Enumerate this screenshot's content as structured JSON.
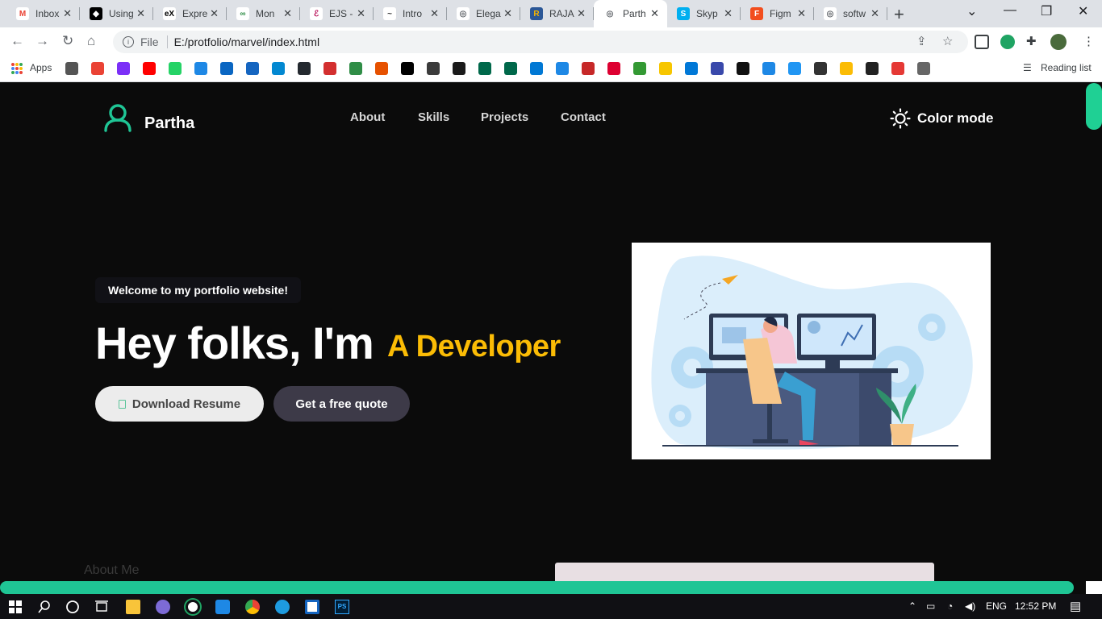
{
  "browser": {
    "tabs": [
      {
        "title": "Inbox",
        "fav": "M",
        "color": "#ffffff",
        "fg": "#ea4335"
      },
      {
        "title": "Using",
        "fav": "◆",
        "color": "#000000",
        "fg": "#ffffff"
      },
      {
        "title": "Expre",
        "fav": "eX",
        "color": "#ffffff",
        "fg": "#000000"
      },
      {
        "title": "Mon",
        "fav": "∞",
        "color": "#ffffff",
        "fg": "#2f8d46"
      },
      {
        "title": "EJS -",
        "fav": "ℰ",
        "color": "#ffffff",
        "fg": "#b4004e"
      },
      {
        "title": "Intro",
        "fav": "~",
        "color": "#ffffff",
        "fg": "#333333"
      },
      {
        "title": "Elega",
        "fav": "◎",
        "color": "#ffffff",
        "fg": "#5f6368"
      },
      {
        "title": "RAJA",
        "fav": "R",
        "color": "#2b5797",
        "fg": "#f4b400"
      },
      {
        "title": "Parth",
        "fav": "◎",
        "color": "#ffffff",
        "fg": "#5f6368",
        "active": true
      },
      {
        "title": "Skyp",
        "fav": "S",
        "color": "#00aff0",
        "fg": "#ffffff"
      },
      {
        "title": "Figm",
        "fav": "F",
        "color": "#f24e1e",
        "fg": "#ffffff"
      },
      {
        "title": "softw",
        "fav": "◎",
        "color": "#ffffff",
        "fg": "#5f6368"
      }
    ],
    "url_scheme": "File",
    "url": "E:/protfolio/marvel/index.html",
    "apps_label": "Apps",
    "reading_list_label": "Reading list",
    "bookmark_colors": [
      "#555555",
      "#ea4335",
      "#7b2ff7",
      "#ff0000",
      "#25d366",
      "#1e88e5",
      "#0a66c2",
      "#1565c0",
      "#0288d1",
      "#24292f",
      "#d32f2f",
      "#2f8d46",
      "#e65100",
      "#000000",
      "#3b3b3b",
      "#1a1a1a",
      "#00684a",
      "#00684a",
      "#0078d4",
      "#1e88e5",
      "#c62828",
      "#dd0031",
      "#339933",
      "#f7c600",
      "#0078d7",
      "#3949ab",
      "#111111",
      "#1e88e5",
      "#2196f3",
      "#333333",
      "#fbbc05",
      "#222222",
      "#e53935",
      "#666666"
    ]
  },
  "site": {
    "brand": "Partha",
    "nav": [
      "About",
      "Skills",
      "Projects",
      "Contact"
    ],
    "color_mode_label": "Color mode",
    "welcome_pill": "Welcome to my portfolio website!",
    "hero_static": "Hey folks, I'm",
    "hero_typed": "A Developer",
    "download_button": "Download Resume",
    "quote_button": "Get a free quote",
    "about_label": "About Me",
    "accent": "#1fc595",
    "highlight": "#fbbc05"
  },
  "taskbar": {
    "tray_lang": "ENG",
    "tray_time": "12:52 PM"
  }
}
